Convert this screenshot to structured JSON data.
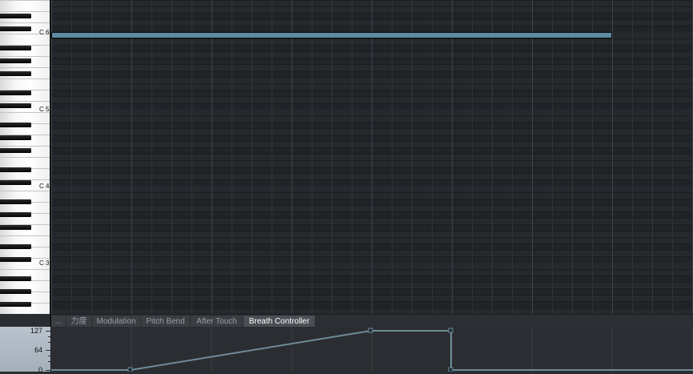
{
  "piano_roll": {
    "octave_labels": [
      "C 6",
      "C 5",
      "C 4",
      "C 3"
    ]
  },
  "note": {
    "pitch": "C 6"
  },
  "controller_tabs": [
    {
      "label": "...",
      "active": false
    },
    {
      "label": "力度",
      "active": false
    },
    {
      "label": "Modulation",
      "active": false
    },
    {
      "label": "Pitch Bend",
      "active": false
    },
    {
      "label": "After Touch",
      "active": false
    },
    {
      "label": "Breath Controller",
      "active": true
    }
  ],
  "controller_lane": {
    "controller": "Breath Controller",
    "axis_labels": [
      "127",
      "64",
      "0"
    ],
    "value_range": [
      0,
      127
    ],
    "line_color": "#6e8c99"
  },
  "colors": {
    "note_fill": "#5d8ba3",
    "grid_bg": "#25282c",
    "active_tab": "#4b4f55"
  }
}
